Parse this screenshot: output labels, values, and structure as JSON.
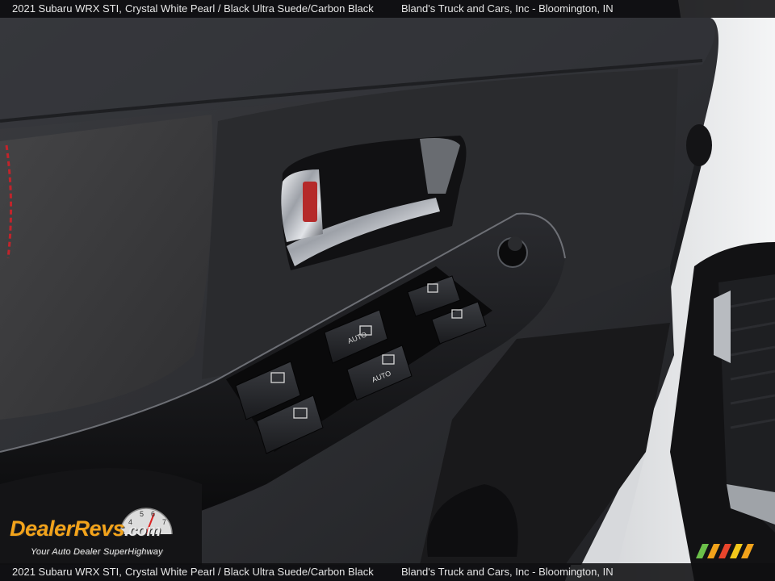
{
  "caption": {
    "vehicle": "2021 Subaru WRX STI,",
    "colors": "Crystal White Pearl / Black Ultra Suede/Carbon Black",
    "dealer": "Bland's Truck and Cars, Inc - Bloomington, IN"
  },
  "watermark": {
    "brand": "DealerRevs",
    "domain": ".com",
    "tagline": "Your Auto Dealer SuperHighway",
    "gauge_numbers": [
      "4",
      "5",
      "6",
      "7"
    ]
  },
  "switch_labels": [
    "AUTO",
    "AUTO"
  ],
  "colors": {
    "door_panel": "#2c2d30",
    "suede": "#3a3a3c",
    "piano_black": "#0d0d0f",
    "chrome": "#c9ccd1",
    "red_stitch": "#c2242b",
    "brand_orange": "#f2a31b",
    "exterior_white": "#e9eaec"
  }
}
